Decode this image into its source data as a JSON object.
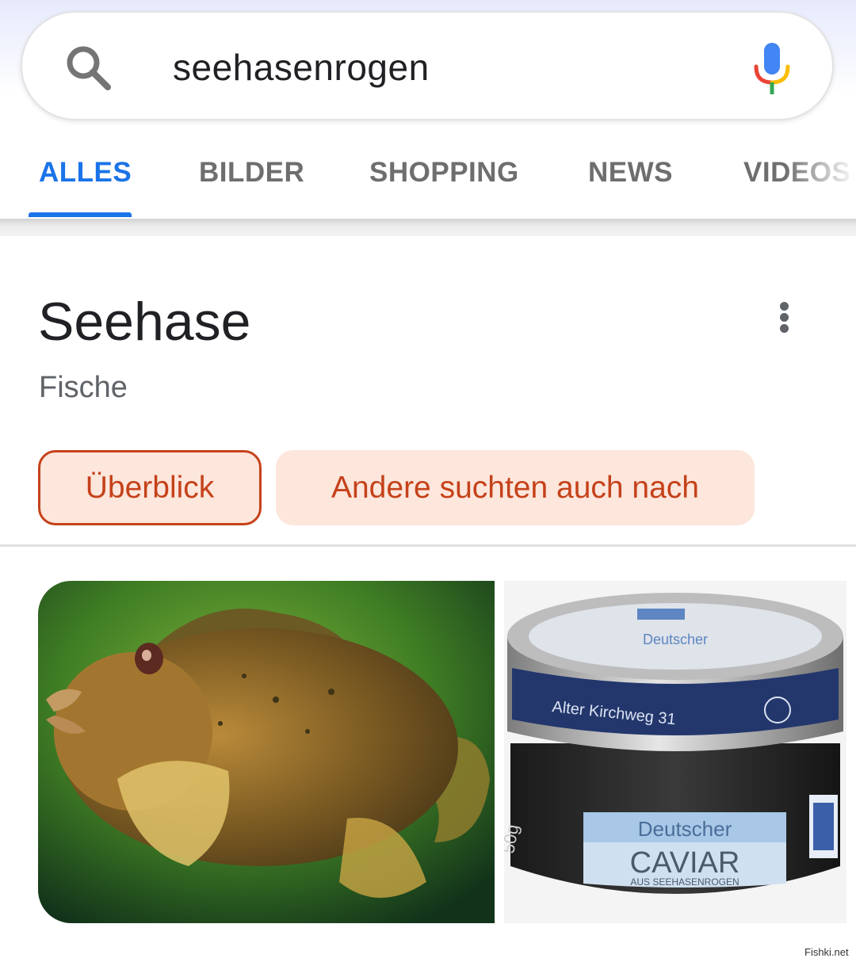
{
  "search": {
    "query": "seehasenrogen",
    "search_icon": "search-icon",
    "mic_icon": "microphone-icon"
  },
  "tabs": [
    {
      "label": "ALLES",
      "active": true
    },
    {
      "label": "BILDER",
      "active": false
    },
    {
      "label": "SHOPPING",
      "active": false
    },
    {
      "label": "NEWS",
      "active": false
    },
    {
      "label": "VIDEOS",
      "active": false
    }
  ],
  "knowledge_panel": {
    "title": "Seehase",
    "subtitle": "Fische",
    "menu_icon": "more-vert-icon",
    "chips": [
      {
        "label": "Überblick",
        "selected": true
      },
      {
        "label": "Andere suchten auch nach",
        "selected": false
      }
    ]
  },
  "images": {
    "jar_lid_text": "Deutscher",
    "jar_band_text": "Alter Kirchweg 31",
    "jar_weight_text": "50g",
    "jar_label_line1": "Deutscher",
    "jar_label_line2": "CAVIAR",
    "jar_label_line3": "AUS SEEHASENROGEN"
  },
  "colors": {
    "accent_blue": "#1a73e8",
    "chip_text": "#c5421a",
    "chip_bg": "#fde6dc"
  },
  "watermark": "Fishki.net"
}
